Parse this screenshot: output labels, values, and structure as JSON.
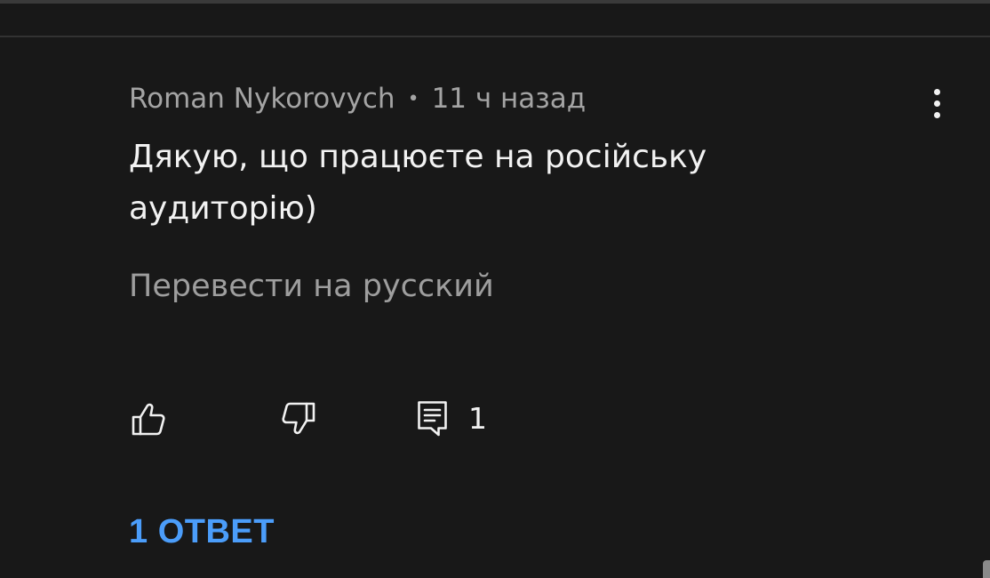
{
  "comment": {
    "author": "Roman Nykorovych",
    "separator": "•",
    "timestamp": "11 ч назад",
    "text": "Дякую, що працюєте на російську аудиторію)",
    "translate_label": "Перевести на русский",
    "reply_count": "1",
    "replies_toggle_label": "1 ОТВЕТ"
  },
  "icons": {
    "like": "thumbs-up-icon",
    "dislike": "thumbs-down-icon",
    "reply": "comment-icon",
    "more": "more-vertical-icon"
  },
  "colors": {
    "background": "#181818",
    "primary_text": "#f2f2f2",
    "secondary_text": "#a4a4a4",
    "link_accent": "#4b9dfa"
  }
}
